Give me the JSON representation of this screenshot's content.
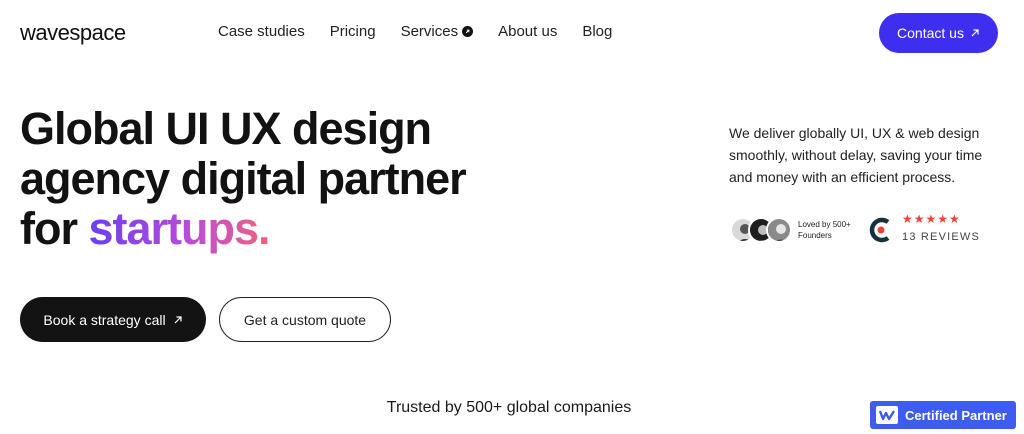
{
  "header": {
    "logo": "wavespace",
    "nav": [
      {
        "label": "Case studies"
      },
      {
        "label": "Pricing"
      },
      {
        "label": "Services"
      },
      {
        "label": "About us"
      },
      {
        "label": "Blog"
      }
    ],
    "contact_label": "Contact us"
  },
  "hero": {
    "title_line1": "Global UI UX design",
    "title_line2": "agency digital partner",
    "title_line3_prefix": "for ",
    "title_line3_highlight": "startups.",
    "description": "We deliver globally UI, UX & web design smoothly, without delay, saving your time and money with an efficient process.",
    "loved_line1": "Loved by 500+",
    "loved_line2": "Founders",
    "stars": "★★★★★",
    "reviews": "13 REVIEWS",
    "primary_cta": "Book a strategy call",
    "secondary_cta": "Get a custom quote"
  },
  "trusted_text": "Trusted by 500+ global companies",
  "badge_text": "Certified Partner",
  "colors": {
    "accent": "#3d2ef0",
    "dark": "#131313",
    "badge": "#3e5cf0",
    "stars": "#ef4335"
  }
}
